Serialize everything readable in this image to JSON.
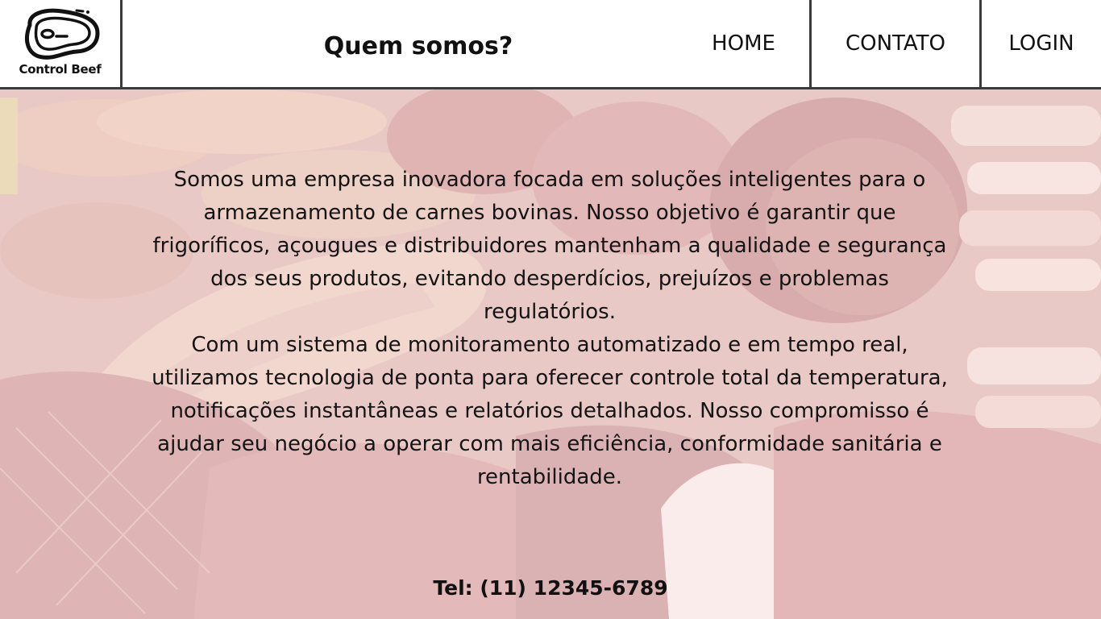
{
  "brand": {
    "name": "Control Beef",
    "logo_icon": "steak-icon"
  },
  "header": {
    "title": "Quem somos?"
  },
  "nav": {
    "home": "HOME",
    "contato": "CONTATO",
    "login": "LOGIN"
  },
  "about": {
    "paragraph1": "Somos uma empresa inovadora focada em soluções inteligentes para o armazenamento de carnes bovinas. Nosso objetivo é garantir que frigoríficos, açougues e distribuidores mantenham a qualidade e segurança dos seus produtos, evitando desperdícios, prejuízos e problemas regulatórios.",
    "paragraph2": "Com um sistema de monitoramento automatizado e em tempo real, utilizamos tecnologia de ponta para oferecer controle total da temperatura, notificações instantâneas e relatórios detalhados. Nosso compromisso é ajudar seu negócio a operar com mais eficiência, conformidade sanitária e rentabilidade."
  },
  "footer": {
    "phone": "Tel: (11) 12345-6789"
  },
  "colors": {
    "header_bg": "#ffffff",
    "border": "#3a3a3a",
    "text": "#111111",
    "background_tint": "#d7a49e"
  }
}
